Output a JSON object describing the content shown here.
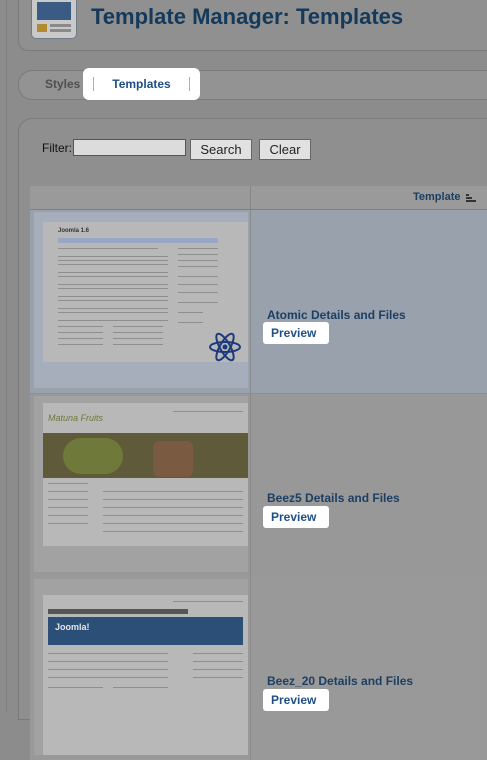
{
  "header": {
    "title": "Template Manager: Templates",
    "logo_icon": "template-manager-icon"
  },
  "tabs": [
    {
      "label": "Styles"
    },
    {
      "label": "Templates"
    }
  ],
  "filter": {
    "label": "Filter:",
    "value": "",
    "search_label": "Search",
    "clear_label": "Clear"
  },
  "table": {
    "header": {
      "template_label": "Template",
      "sort_icon": "sort-icon"
    },
    "rows": [
      {
        "details_label": "Atomic Details and Files",
        "preview_label": "Preview",
        "thumb_title": "Joomla 1.6"
      },
      {
        "details_label": "Beez5 Details and Files",
        "preview_label": "Preview",
        "thumb_title": "Matuna Fruits"
      },
      {
        "details_label": "Beez_20 Details and Files",
        "preview_label": "Preview",
        "thumb_title": "Joomla!"
      }
    ]
  },
  "colors": {
    "title": "#14395a",
    "link": "#1e4f86",
    "highlight": "#ffffff"
  }
}
